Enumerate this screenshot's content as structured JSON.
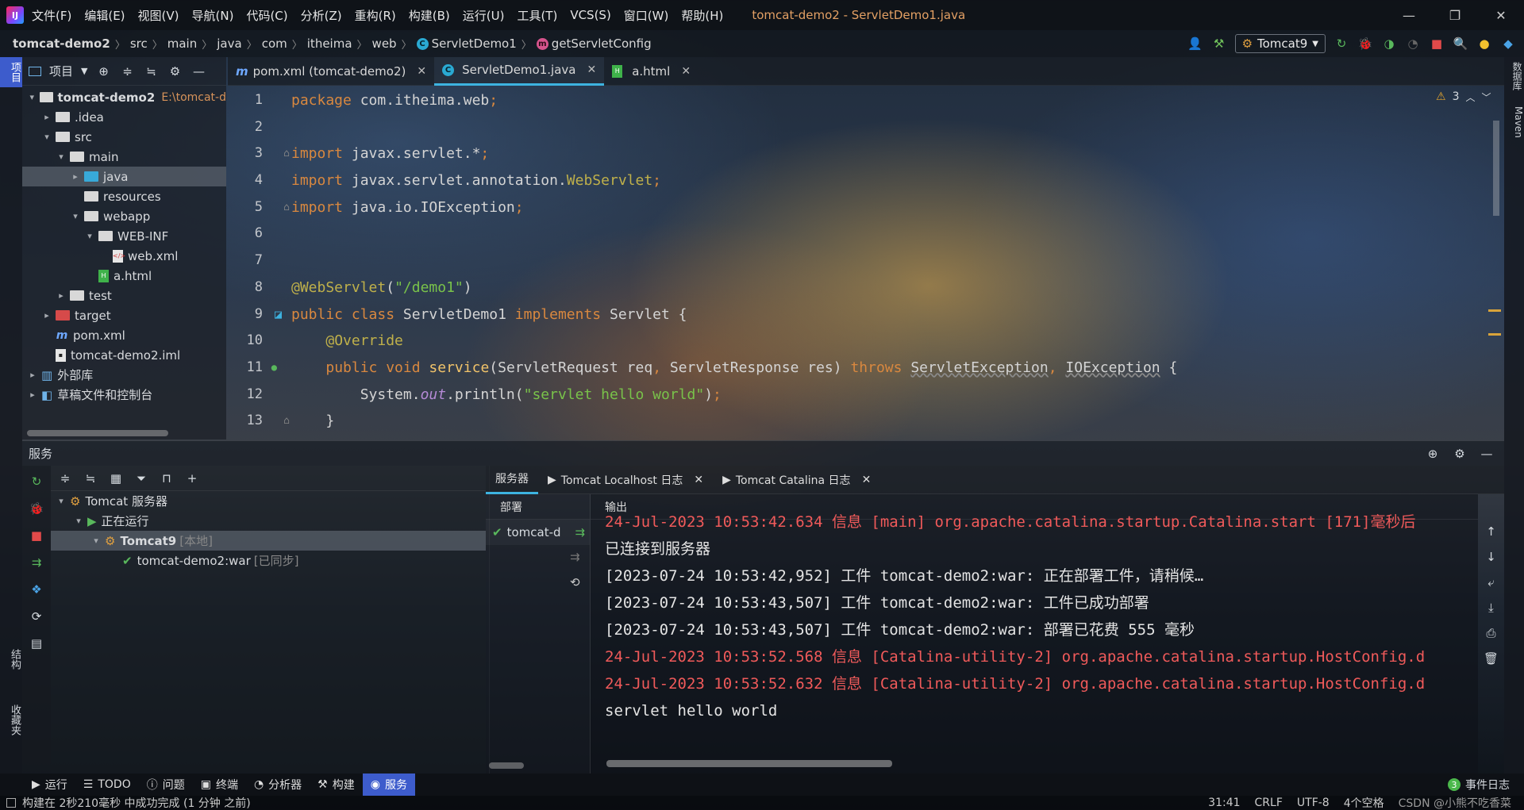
{
  "menu": {
    "logo": "IJ",
    "items": [
      "文件(F)",
      "编辑(E)",
      "视图(V)",
      "导航(N)",
      "代码(C)",
      "分析(Z)",
      "重构(R)",
      "构建(B)",
      "运行(U)",
      "工具(T)",
      "VCS(S)",
      "窗口(W)",
      "帮助(H)"
    ],
    "window_title": "tomcat-demo2 - ServletDemo1.java"
  },
  "breadcrumb": [
    "tomcat-demo2",
    "src",
    "main",
    "java",
    "com",
    "itheima",
    "web",
    "ServletDemo1",
    "getServletConfig"
  ],
  "toolbar": {
    "run_config": "Tomcat9"
  },
  "left_strip": {
    "project_tab": "项目",
    "structure_tab": "结构",
    "favorites_tab": "收藏夹"
  },
  "right_strip": {
    "database_tab": "数据库",
    "maven_tab": "Maven"
  },
  "project_panel": {
    "title": "项目",
    "tree": [
      {
        "label": "tomcat-demo2",
        "hint": "E:\\tomcat-d",
        "kind": "module",
        "depth": 0,
        "arrow": "▾"
      },
      {
        "label": ".idea",
        "kind": "folder",
        "depth": 1,
        "arrow": "▸"
      },
      {
        "label": "src",
        "kind": "folder",
        "depth": 1,
        "arrow": "▾"
      },
      {
        "label": "main",
        "kind": "folder",
        "depth": 2,
        "arrow": "▾"
      },
      {
        "label": "java",
        "kind": "folder-blue",
        "depth": 3,
        "arrow": "▸",
        "selected": true
      },
      {
        "label": "resources",
        "kind": "folder",
        "depth": 3,
        "arrow": ""
      },
      {
        "label": "webapp",
        "kind": "folder-web",
        "depth": 3,
        "arrow": "▾"
      },
      {
        "label": "WEB-INF",
        "kind": "folder",
        "depth": 4,
        "arrow": "▾"
      },
      {
        "label": "web.xml",
        "kind": "xml",
        "depth": 5,
        "arrow": ""
      },
      {
        "label": "a.html",
        "kind": "html",
        "depth": 4,
        "arrow": ""
      },
      {
        "label": "test",
        "kind": "folder",
        "depth": 2,
        "arrow": "▸"
      },
      {
        "label": "target",
        "kind": "folder-red",
        "depth": 1,
        "arrow": "▸"
      },
      {
        "label": "pom.xml",
        "kind": "maven",
        "depth": 1,
        "arrow": ""
      },
      {
        "label": "tomcat-demo2.iml",
        "kind": "iml",
        "depth": 1,
        "arrow": ""
      },
      {
        "label": "外部库",
        "kind": "lib",
        "depth": 0,
        "arrow": "▸"
      },
      {
        "label": "草稿文件和控制台",
        "kind": "scratch",
        "depth": 0,
        "arrow": "▸"
      }
    ]
  },
  "editor": {
    "tabs": [
      {
        "label": "pom.xml (tomcat-demo2)",
        "icon": "m",
        "active": false
      },
      {
        "label": "ServletDemo1.java",
        "icon": "c",
        "active": true
      },
      {
        "label": "a.html",
        "icon": "html",
        "active": false
      }
    ],
    "warnings_count": "3",
    "line_numbers": [
      "1",
      "2",
      "3",
      "4",
      "5",
      "6",
      "7",
      "8",
      "9",
      "10",
      "11",
      "12",
      "13"
    ]
  },
  "services": {
    "title": "服务",
    "tree": [
      {
        "label": "Tomcat 服务器",
        "hint": "",
        "depth": 0,
        "arrow": "▾"
      },
      {
        "label": "正在运行",
        "hint": "",
        "depth": 1,
        "arrow": "▾"
      },
      {
        "label": "Tomcat9",
        "hint": "[本地]",
        "depth": 2,
        "arrow": "▾",
        "selected": true,
        "bold": true
      },
      {
        "label": "tomcat-demo2:war",
        "hint": "[已同步]",
        "depth": 3,
        "arrow": ""
      }
    ],
    "tabs": [
      {
        "label": "服务器",
        "active": true
      },
      {
        "label": "Tomcat Localhost 日志",
        "active": false
      },
      {
        "label": "Tomcat Catalina 日志",
        "active": false
      }
    ],
    "deploy_header": "部署",
    "deploy_item": "tomcat-d",
    "output_header": "输出",
    "output_lines": [
      {
        "text": "24-Jul-2023 10:53:42.634 信息 [main] org.apache.catalina.startup.Catalina.start [171]毫秒后",
        "red": true
      },
      {
        "text": "已连接到服务器",
        "red": false
      },
      {
        "text": "[2023-07-24 10:53:42,952] 工件 tomcat-demo2:war: 正在部署工件，请稍候…",
        "red": false
      },
      {
        "text": "[2023-07-24 10:53:43,507] 工件 tomcat-demo2:war: 工件已成功部署",
        "red": false
      },
      {
        "text": "[2023-07-24 10:53:43,507] 工件 tomcat-demo2:war: 部署已花费 555 毫秒",
        "red": false
      },
      {
        "text": "24-Jul-2023 10:53:52.568 信息 [Catalina-utility-2] org.apache.catalina.startup.HostConfig.d",
        "red": true
      },
      {
        "text": "24-Jul-2023 10:53:52.632 信息 [Catalina-utility-2] org.apache.catalina.startup.HostConfig.d",
        "red": true
      },
      {
        "text": "servlet hello world",
        "red": false
      }
    ]
  },
  "bottom_tabs": [
    {
      "label": "运行",
      "icon": "play-icon",
      "active": false
    },
    {
      "label": "TODO",
      "icon": "list-icon",
      "active": false
    },
    {
      "label": "问题",
      "icon": "info-icon",
      "active": false
    },
    {
      "label": "终端",
      "icon": "terminal-icon",
      "active": false
    },
    {
      "label": "分析器",
      "icon": "profiler-icon",
      "active": false
    },
    {
      "label": "构建",
      "icon": "hammer-icon",
      "active": false
    },
    {
      "label": "服务",
      "icon": "services-icon",
      "active": true
    }
  ],
  "event_log": {
    "count": "3",
    "label": "事件日志"
  },
  "status": {
    "message": "构建在 2秒210毫秒 中成功完成 (1 分钟 之前)",
    "position": "31:41",
    "line_sep": "CRLF",
    "encoding": "UTF-8",
    "indent": "4个空格",
    "watermark": "CSDN @小熊不吃香菜"
  },
  "colors": {
    "accent": "#3d5ccc",
    "tab_underline": "#3db3e0",
    "title": "#e3a064"
  }
}
